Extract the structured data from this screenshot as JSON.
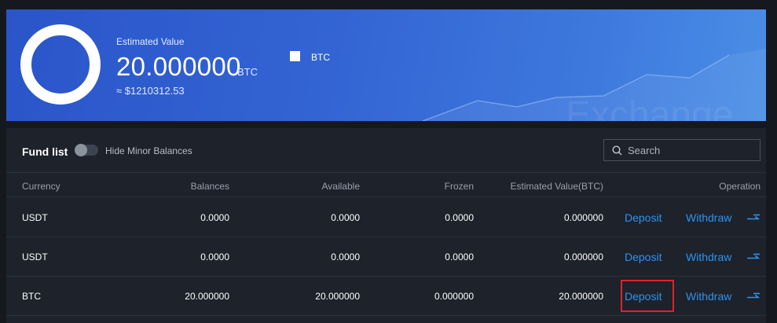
{
  "banner": {
    "estimated_label": "Estimated Value",
    "estimated_value": "20.000000",
    "estimated_unit": "BTC",
    "usd_value": "≈ $1210312.53",
    "legend_label": "BTC",
    "watermark": "Exchange"
  },
  "fund_list": {
    "title": "Fund list",
    "toggle_label": "Hide Minor Balances",
    "toggle_on": false,
    "search_placeholder": "Search",
    "columns": [
      "Currency",
      "Balances",
      "Available",
      "Frozen",
      "Estimated Value(BTC)",
      "Operation"
    ],
    "rows": [
      {
        "currency": "USDT",
        "balances": "0.0000",
        "available": "0.0000",
        "frozen": "0.0000",
        "est_value": "0.000000",
        "deposit": "Deposit",
        "withdraw": "Withdraw"
      },
      {
        "currency": "USDT",
        "balances": "0.0000",
        "available": "0.0000",
        "frozen": "0.0000",
        "est_value": "0.000000",
        "deposit": "Deposit",
        "withdraw": "Withdraw"
      },
      {
        "currency": "BTC",
        "balances": "20.000000",
        "available": "20.000000",
        "frozen": "0.000000",
        "est_value": "20.000000",
        "deposit": "Deposit",
        "withdraw": "Withdraw"
      }
    ]
  },
  "colors": {
    "accent_link": "#2f93f0",
    "highlight_box": "#e0222a",
    "banner_start": "#2a55c9",
    "banner_end": "#4a8ee6"
  },
  "icons": {
    "search": "search-icon",
    "operation": "transfer-icon"
  }
}
